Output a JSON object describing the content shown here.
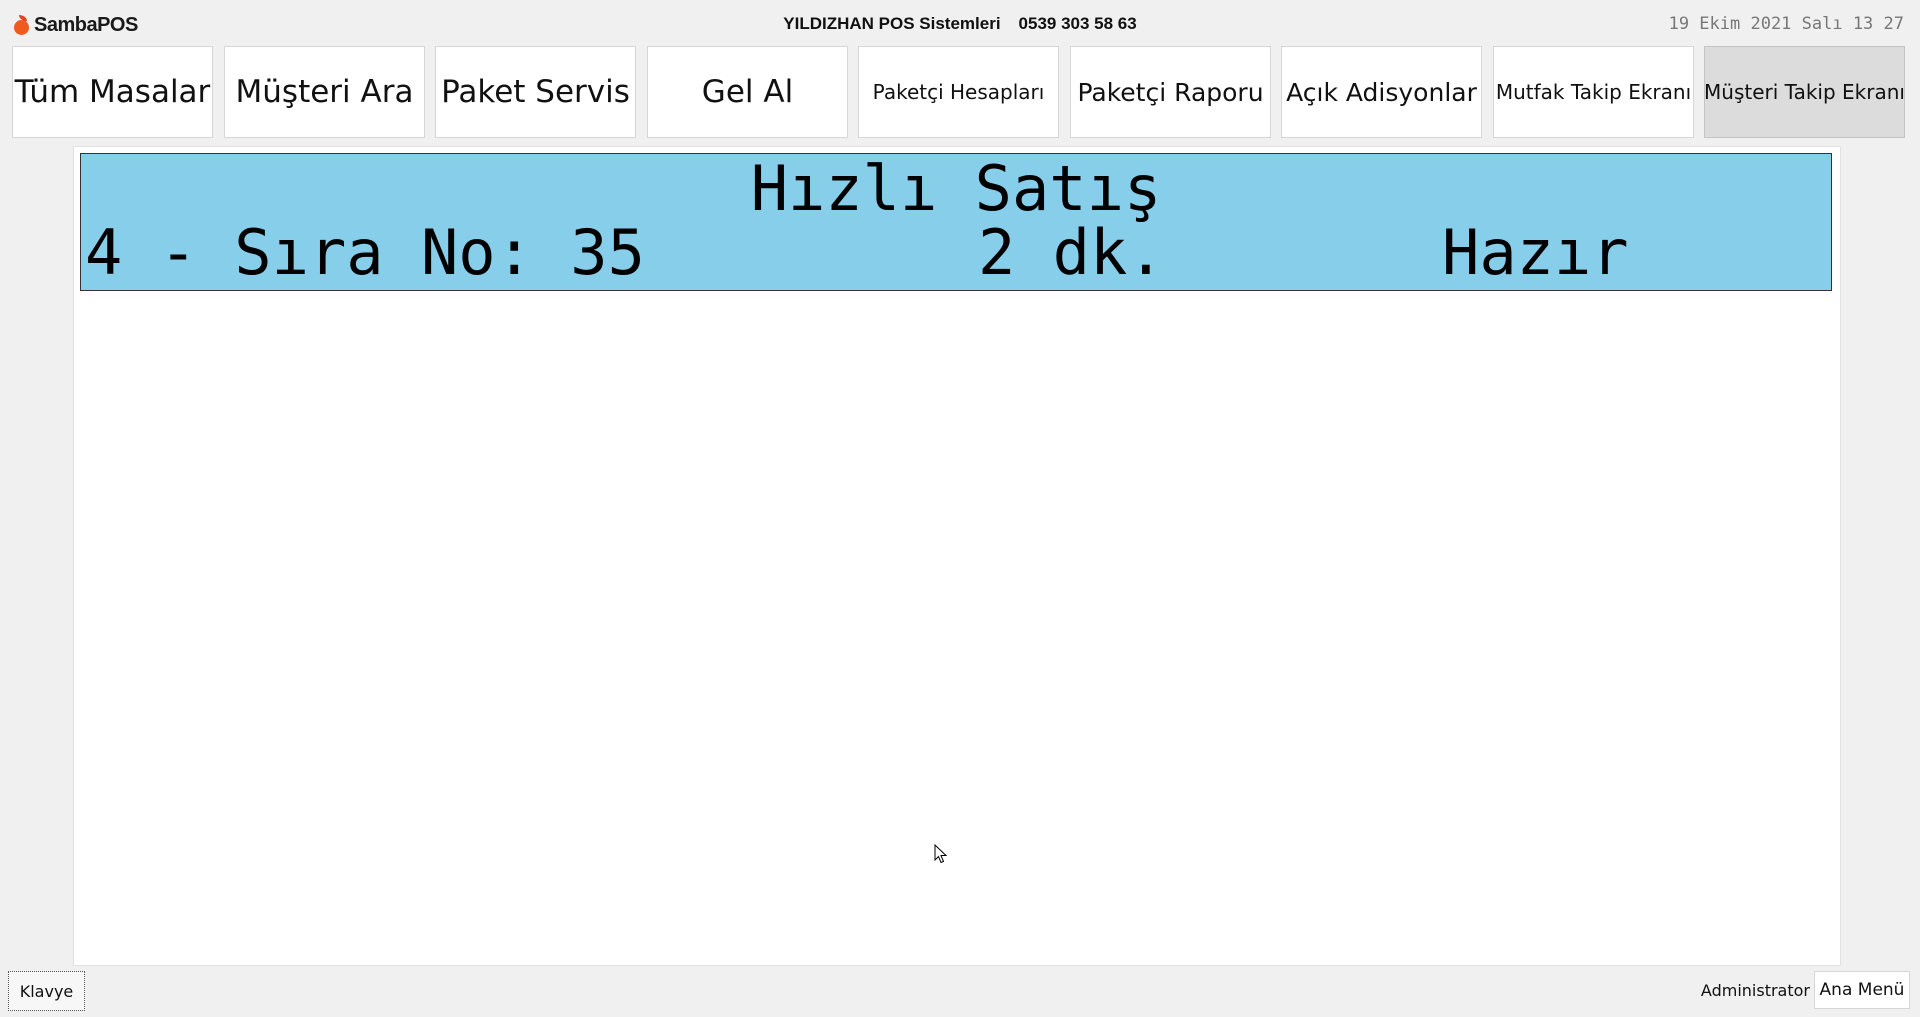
{
  "header": {
    "logo_text": "SambaPOS",
    "company_name": "YILDIZHAN POS Sistemleri",
    "phone": "0539 303 58 63",
    "datetime": "19 Ekim 2021 Salı 13 27"
  },
  "nav": {
    "items": [
      {
        "label": "Tüm Masalar"
      },
      {
        "label": "Müşteri Ara"
      },
      {
        "label": "Paket Servis"
      },
      {
        "label": "Gel Al"
      },
      {
        "label": "Paketçi Hesapları"
      },
      {
        "label": "Paketçi Raporu"
      },
      {
        "label": "Açık Adisyonlar"
      },
      {
        "label": "Mutfak Takip Ekranı"
      },
      {
        "label": "Müşteri Takip Ekranı",
        "active": true
      }
    ]
  },
  "ticket": {
    "title": "Hızlı Satış",
    "order_info": "4 - Sıra No: 35",
    "elapsed": "2 dk.",
    "status": "Hazır",
    "background_color": "#87ceeb"
  },
  "footer": {
    "keyboard_label": "Klavye",
    "user_name": "Administrator",
    "main_menu_label": "Ana Menü"
  },
  "icons": {
    "logo": "sambapos-logo-icon",
    "cursor": "mouse-pointer-icon"
  }
}
